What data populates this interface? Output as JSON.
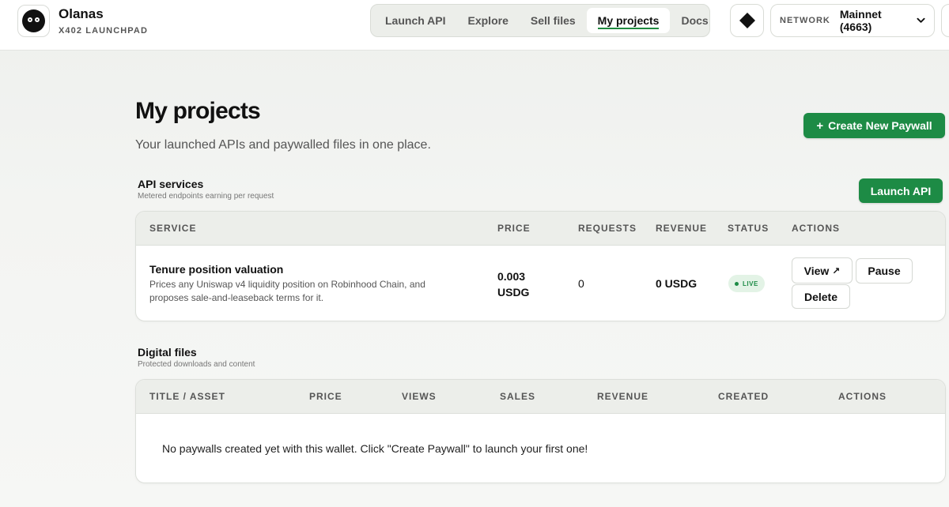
{
  "header": {
    "brand_name": "Olanas",
    "brand_sub": "X402 LAUNCHPAD",
    "nav": [
      {
        "label": "Launch API"
      },
      {
        "label": "Explore"
      },
      {
        "label": "Sell files"
      },
      {
        "label": "My projects",
        "active": true
      },
      {
        "label": "Docs"
      }
    ],
    "chain_icon": "diamond-chain-icon",
    "network_label": "NETWORK",
    "network_value": "Mainnet (4663)"
  },
  "page": {
    "title": "My projects",
    "subtitle": "Your launched APIs and paywalled files in one place.",
    "create_button": "Create New Paywall",
    "create_button_icon": "+"
  },
  "api_section": {
    "title": "API services",
    "subtitle": "Metered endpoints earning per request",
    "launch_button": "Launch API",
    "columns": [
      "SERVICE",
      "PRICE",
      "REQUESTS",
      "REVENUE",
      "STATUS",
      "ACTIONS"
    ],
    "rows": [
      {
        "name": "Tenure position valuation",
        "description": "Prices any Uniswap v4 liquidity position on Robinhood Chain, and proposes sale-and-leaseback terms for it.",
        "price": "0.003 USDG",
        "requests": "0",
        "revenue": "0 USDG",
        "status": "LIVE",
        "actions": {
          "view": "View",
          "pause": "Pause",
          "delete": "Delete"
        }
      }
    ]
  },
  "files_section": {
    "title": "Digital files",
    "subtitle": "Protected downloads and content",
    "columns": [
      "TITLE / ASSET",
      "PRICE",
      "VIEWS",
      "SALES",
      "REVENUE",
      "CREATED",
      "ACTIONS"
    ],
    "empty_message": "No paywalls created yet with this wallet. Click \"Create Paywall\" to launch your first one!"
  },
  "colors": {
    "accent": "#1d8b45",
    "badge_bg": "#e3f3e6",
    "header_row_bg": "#eceeea"
  }
}
